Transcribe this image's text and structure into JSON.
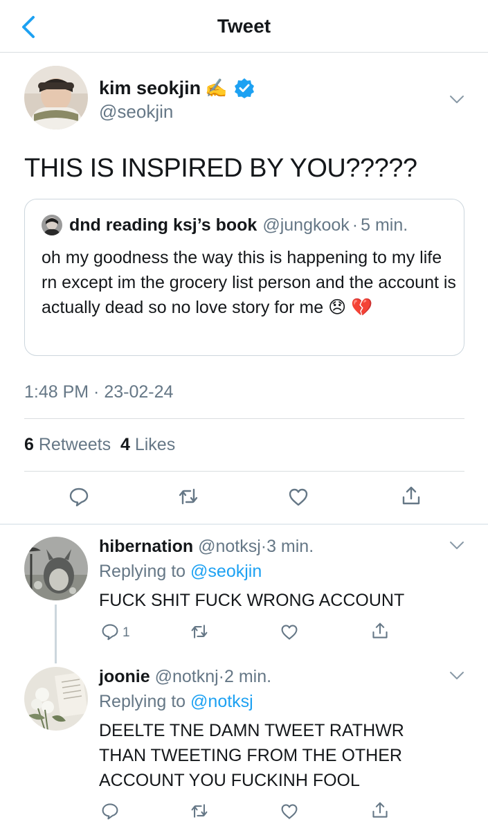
{
  "header": {
    "title": "Tweet"
  },
  "main_tweet": {
    "name": "kim seokjin",
    "name_emoji": "✍️",
    "handle": "@seokjin",
    "text": "THIS IS INSPIRED BY YOU?????",
    "timestamp": "1:48 PM · 23-02-24",
    "retweets_count": "6",
    "retweets_label": "Retweets",
    "likes_count": "4",
    "likes_label": "Likes"
  },
  "quote": {
    "name": "dnd reading ksj’s book",
    "handle": "@jungkook",
    "dot": "·",
    "time": "5 min.",
    "text": "oh my goodness the way this is happening to my life rn except im the grocery list person and the account is actually dead so no love story for me 😞 💔"
  },
  "replies": [
    {
      "name": "hibernation",
      "handle": "@notksj",
      "dot": "·",
      "time": "3 min.",
      "replying_label": "Replying to",
      "replying_to": "@seokjin",
      "text": "FUCK SHIT FUCK WRONG ACCOUNT",
      "reply_count": "1"
    },
    {
      "name": "joonie",
      "handle": "@notknj",
      "dot": "·",
      "time": "2 min.",
      "replying_label": "Replying to",
      "replying_to": "@notksj",
      "text": "DEELTE TNE DAMN TWEET RATHWR THAN TWEETING FROM THE OTHER ACCOUNT YOU FUCKINH FOOL"
    }
  ],
  "colors": {
    "accent": "#1da1f2",
    "secondary_text": "#657786",
    "border": "#d9dde0",
    "verified": "#1da1f2"
  },
  "icons": [
    "back-chevron-icon",
    "verified-badge-icon",
    "chevron-down-icon",
    "reply-icon",
    "retweet-icon",
    "like-icon",
    "share-icon"
  ]
}
